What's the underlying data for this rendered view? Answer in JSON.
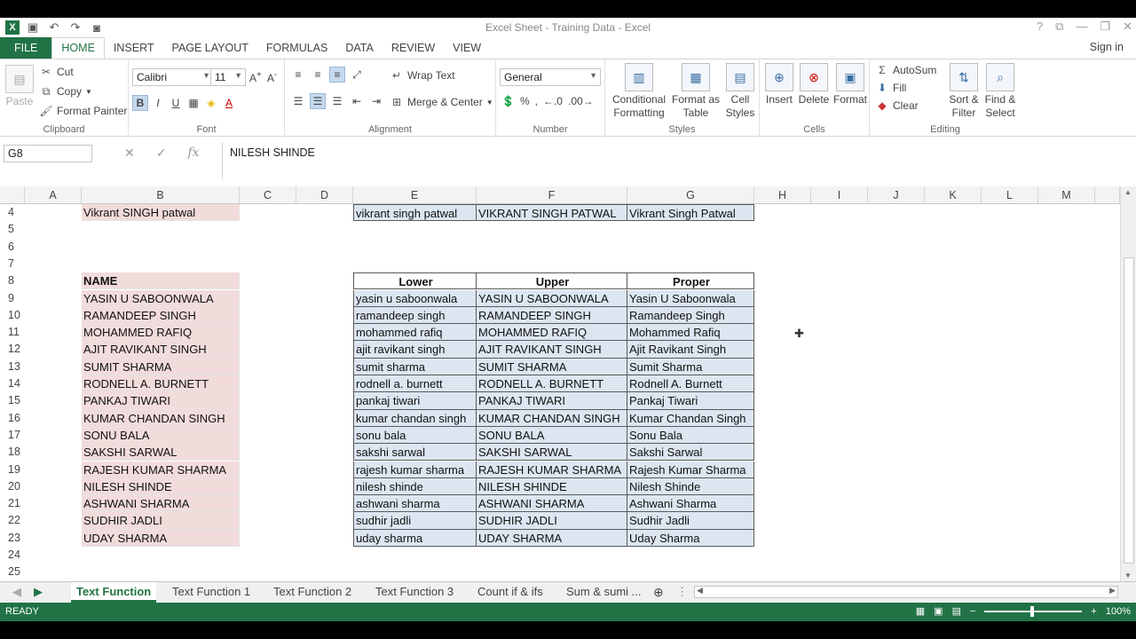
{
  "window": {
    "title": "Excel Sheet - Training Data - Excel",
    "signin": "Sign in"
  },
  "ribbon_tabs": [
    "FILE",
    "HOME",
    "INSERT",
    "PAGE LAYOUT",
    "FORMULAS",
    "DATA",
    "REVIEW",
    "VIEW"
  ],
  "clipboard": {
    "paste": "Paste",
    "cut": "Cut",
    "copy": "Copy",
    "format_painter": "Format Painter",
    "label": "Clipboard"
  },
  "font": {
    "name": "Calibri",
    "size": "11",
    "bold": "B",
    "italic": "I",
    "underline": "U",
    "label": "Font"
  },
  "alignment": {
    "wrap": "Wrap Text",
    "merge": "Merge & Center",
    "label": "Alignment"
  },
  "number": {
    "format": "General",
    "label": "Number"
  },
  "styles": {
    "conditional": "Conditional Formatting",
    "format_table": "Format as Table",
    "cell_styles": "Cell Styles",
    "label": "Styles"
  },
  "cells": {
    "insert": "Insert",
    "delete": "Delete",
    "format": "Format",
    "label": "Cells"
  },
  "editing": {
    "autosum": "AutoSum",
    "fill": "Fill",
    "clear": "Clear",
    "sort": "Sort & Filter",
    "find": "Find & Select",
    "label": "Editing"
  },
  "formula_bar": {
    "name_box": "G8",
    "fx": "fx",
    "value": "NILESH  SHINDE"
  },
  "columns": [
    "A",
    "B",
    "C",
    "D",
    "E",
    "F",
    "G",
    "H",
    "I",
    "J",
    "K",
    "L",
    "M"
  ],
  "rows": [
    "4",
    "5",
    "6",
    "7",
    "8",
    "9",
    "10",
    "11",
    "12",
    "13",
    "14",
    "15",
    "16",
    "17",
    "18",
    "19",
    "20",
    "21",
    "22",
    "23",
    "24",
    "25"
  ],
  "row4": {
    "b": "Vikrant SINGH patwal",
    "e": "vikrant singh patwal",
    "f": "VIKRANT SINGH PATWAL",
    "g": "Vikrant Singh Patwal"
  },
  "table_headers": {
    "name": "NAME",
    "lower": "Lower",
    "upper": "Upper",
    "proper": "Proper"
  },
  "names": [
    {
      "b": "YASIN U SABOONWALA",
      "e": "yasin u saboonwala",
      "f": "YASIN U SABOONWALA",
      "g": "Yasin U Saboonwala"
    },
    {
      "b": "RAMANDEEP SINGH",
      "e": "ramandeep singh",
      "f": "RAMANDEEP SINGH",
      "g": "Ramandeep Singh"
    },
    {
      "b": "MOHAMMED RAFIQ",
      "e": "mohammed rafiq",
      "f": "MOHAMMED RAFIQ",
      "g": "Mohammed Rafiq"
    },
    {
      "b": "AJIT RAVIKANT SINGH",
      "e": "ajit ravikant singh",
      "f": "AJIT RAVIKANT SINGH",
      "g": "Ajit Ravikant Singh"
    },
    {
      "b": "SUMIT SHARMA",
      "e": "sumit sharma",
      "f": "SUMIT SHARMA",
      "g": "Sumit Sharma"
    },
    {
      "b": "RODNELL A. BURNETT",
      "e": "rodnell a. burnett",
      "f": "RODNELL A. BURNETT",
      "g": "Rodnell A. Burnett"
    },
    {
      "b": "PANKAJ TIWARI",
      "e": "pankaj tiwari",
      "f": "PANKAJ TIWARI",
      "g": "Pankaj Tiwari"
    },
    {
      "b": "KUMAR CHANDAN SINGH",
      "e": "kumar chandan singh",
      "f": "KUMAR CHANDAN SINGH",
      "g": "Kumar Chandan Singh"
    },
    {
      "b": "SONU BALA",
      "e": "sonu bala",
      "f": "SONU BALA",
      "g": "Sonu Bala"
    },
    {
      "b": "SAKSHI SARWAL",
      "e": "sakshi sarwal",
      "f": "SAKSHI SARWAL",
      "g": "Sakshi Sarwal"
    },
    {
      "b": "RAJESH KUMAR SHARMA",
      "e": "rajesh kumar sharma",
      "f": "RAJESH KUMAR SHARMA",
      "g": "Rajesh Kumar Sharma"
    },
    {
      "b": "NILESH  SHINDE",
      "e": "nilesh  shinde",
      "f": "NILESH  SHINDE",
      "g": "Nilesh  Shinde"
    },
    {
      "b": "ASHWANI SHARMA",
      "e": "ashwani sharma",
      "f": "ASHWANI SHARMA",
      "g": "Ashwani Sharma"
    },
    {
      "b": "SUDHIR JADLI",
      "e": "sudhir jadli",
      "f": "SUDHIR JADLI",
      "g": "Sudhir Jadli"
    },
    {
      "b": "UDAY SHARMA",
      "e": "uday sharma",
      "f": "UDAY SHARMA",
      "g": "Uday Sharma"
    }
  ],
  "sheet_tabs": [
    "Text Function",
    "Text Function 1",
    "Text Function 2",
    "Text Function 3",
    "Count if & ifs",
    "Sum & sumi ..."
  ],
  "status": {
    "ready": "READY",
    "zoom": "100%"
  },
  "colors": {
    "accent": "#217346",
    "pink_fill": "#f2dcdb",
    "blue_fill": "#dce6f1"
  }
}
